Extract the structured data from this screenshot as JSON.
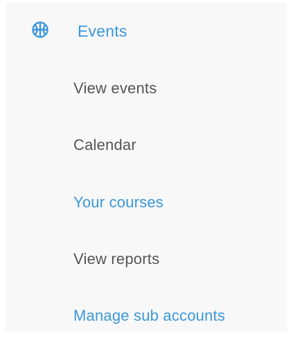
{
  "colors": {
    "accent": "#3b97db",
    "text_default": "#555555",
    "panel_bg": "#f8f8f8"
  },
  "sidebar": {
    "header": {
      "icon": "basketball-icon",
      "label": "Events"
    },
    "items": [
      {
        "label": "View events",
        "active": false
      },
      {
        "label": "Calendar",
        "active": false
      },
      {
        "label": "Your courses",
        "active": true
      },
      {
        "label": "View reports",
        "active": false
      },
      {
        "label": "Manage sub accounts",
        "active": true
      }
    ]
  }
}
